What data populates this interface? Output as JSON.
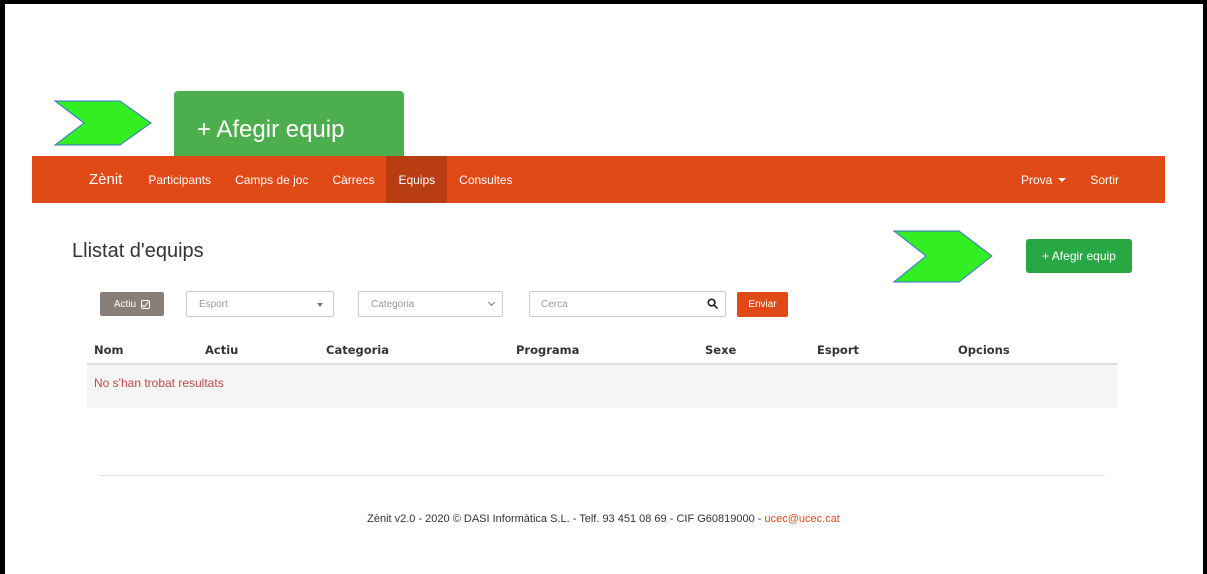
{
  "callout": {
    "label": "+ Afegir equip",
    "arrow_color": "#33ee22"
  },
  "navbar": {
    "brand": "Zènit",
    "items": [
      "Participants",
      "Camps de joc",
      "Càrrecs",
      "Equips",
      "Consultes"
    ],
    "active_item": "Equips",
    "user_menu": "Prova",
    "logout": "Sortir",
    "color": "#e04a17"
  },
  "page": {
    "title": "Llistat d'equips",
    "add_button": "+ Afegir equip"
  },
  "filters": {
    "active_button": "Actiu",
    "sport_placeholder": "Esport",
    "category_placeholder": "Categoria",
    "search_placeholder": "Cerca",
    "submit": "Enviar"
  },
  "table": {
    "columns": [
      "Nom",
      "Actiu",
      "Categoria",
      "Programa",
      "Sexe",
      "Esport",
      "Opcions"
    ],
    "empty_message": "No s'han trobat resultats"
  },
  "footer": {
    "text": "Zènit v2.0 - 2020 © DASI Informàtica S.L. - Telf. 93 451 08 69 - CIF G60819000 - ",
    "email": "ucec@ucec.cat"
  }
}
